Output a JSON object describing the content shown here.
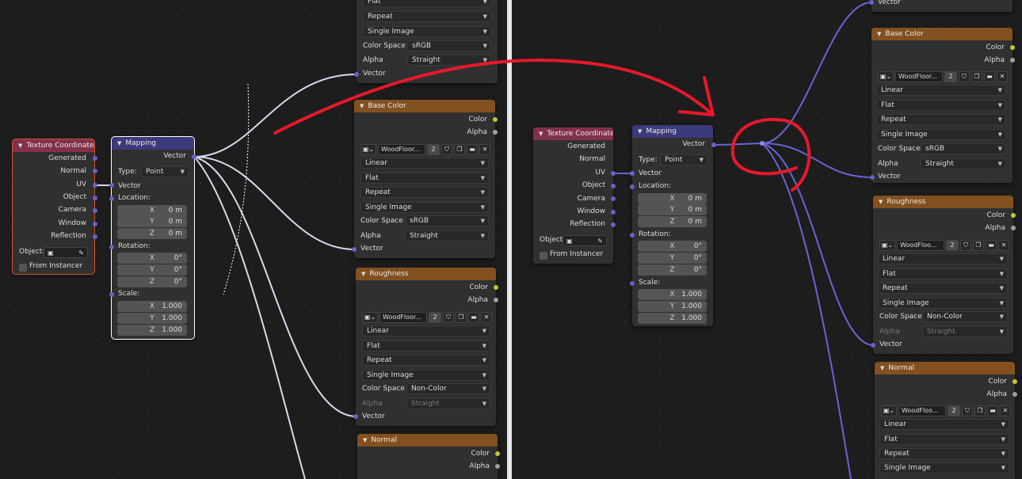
{
  "labels": {
    "texture_coordinate": "Texture Coordinate",
    "generated": "Generated",
    "normal": "Normal",
    "uv": "UV",
    "object": "Object",
    "camera": "Camera",
    "window": "Window",
    "reflection": "Reflection",
    "object_field": "Object:",
    "from_instancer": "From Instancer",
    "mapping": "Mapping",
    "vector": "Vector",
    "type": "Type:",
    "type_value": "Point",
    "location": "Location:",
    "rotation": "Rotation:",
    "scale": "Scale:",
    "x": "X",
    "y": "Y",
    "z": "Z",
    "loc_val": "0 m",
    "rot_val": "0°",
    "scale_val": "1.000",
    "base_color": "Base Color",
    "roughness": "Roughness",
    "normal_node": "Normal",
    "color": "Color",
    "alpha": "Alpha",
    "image_name": "WoodFloor...",
    "image_name_short": "WoodFloo...",
    "users": "2",
    "linear": "Linear",
    "flat": "Flat",
    "repeat": "Repeat",
    "single_image": "Single Image",
    "color_space": "Color Space",
    "srgb": "sRGB",
    "non_color": "Non-Color",
    "straight": "Straight"
  },
  "colors": {
    "texcoord_header": "#83314a",
    "mapping_header": "#3b3a7a",
    "image_header": "#83501f",
    "vector_socket": "#6363c7",
    "color_socket": "#c7c729",
    "float_socket": "#a1a1a1",
    "annotation": "#e8182c"
  }
}
